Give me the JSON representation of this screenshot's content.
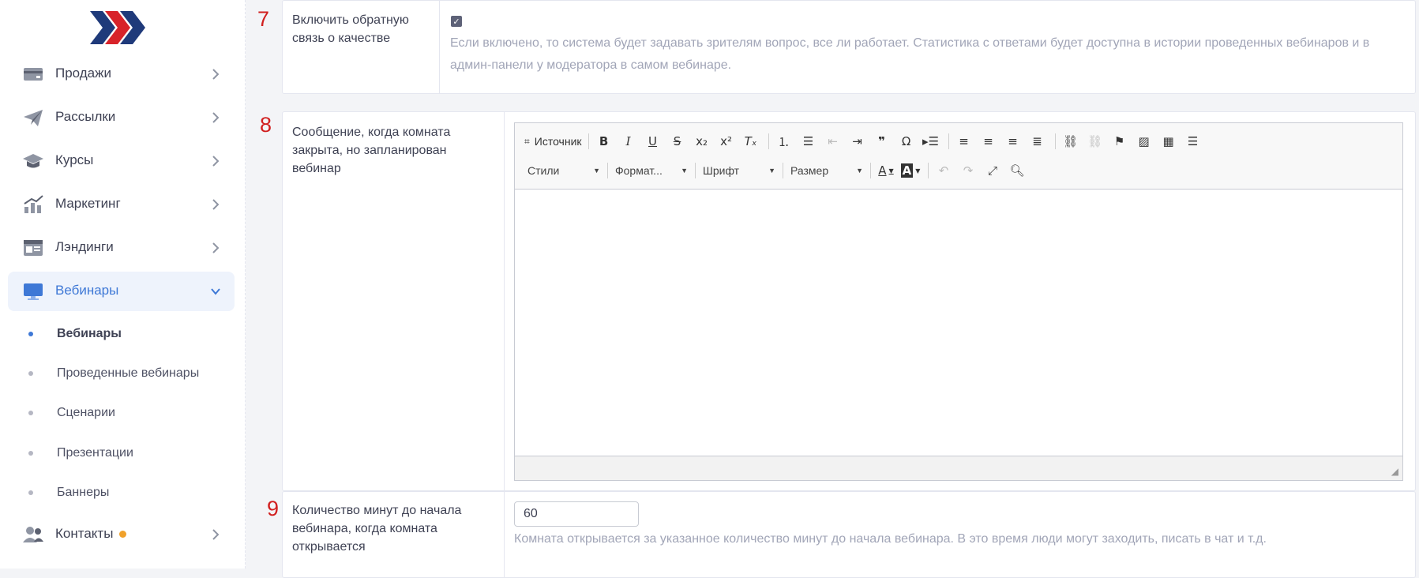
{
  "sidebar": {
    "items": [
      {
        "label": "Продажи",
        "icon": "card-icon"
      },
      {
        "label": "Рассылки",
        "icon": "paper-plane-icon"
      },
      {
        "label": "Курсы",
        "icon": "graduation-cap-icon"
      },
      {
        "label": "Маркетинг",
        "icon": "chart-bars-icon"
      },
      {
        "label": "Лэндинги",
        "icon": "browser-window-icon"
      },
      {
        "label": "Вебинары",
        "icon": "monitor-icon"
      },
      {
        "label": "Контакты",
        "icon": "users-icon"
      }
    ],
    "sub_items": [
      {
        "label": "Вебинары"
      },
      {
        "label": "Проведенные вебинары"
      },
      {
        "label": "Сценарии"
      },
      {
        "label": "Презентации"
      },
      {
        "label": "Баннеры"
      }
    ]
  },
  "settings": [
    {
      "number": "7",
      "label": "Включить обратную связь о качестве",
      "checked": true,
      "help": "Если включено, то система будет задавать зрителям вопрос, все ли работает. Статистика с ответами будет доступна в истории проведенных вебинаров и в админ-панели у модератора в самом вебинаре."
    },
    {
      "number": "8",
      "label": "Сообщение, когда комната закрыта, но запланирован вебинар"
    },
    {
      "number": "9",
      "label": "Количество минут до начала вебинара, когда комната открывается",
      "value": "60",
      "help": "Комната открывается за указанное количество минут до начала вебинара. В это время люди могут заходить, писать в чат и т.д."
    }
  ],
  "editor": {
    "source_label": "Источник",
    "styles_label": "Стили",
    "format_label": "Формат...",
    "font_label": "Шрифт",
    "size_label": "Размер"
  },
  "colors": {
    "accent": "#3e78d6",
    "number": "#d11f1f",
    "badge": "#f0a12b"
  }
}
